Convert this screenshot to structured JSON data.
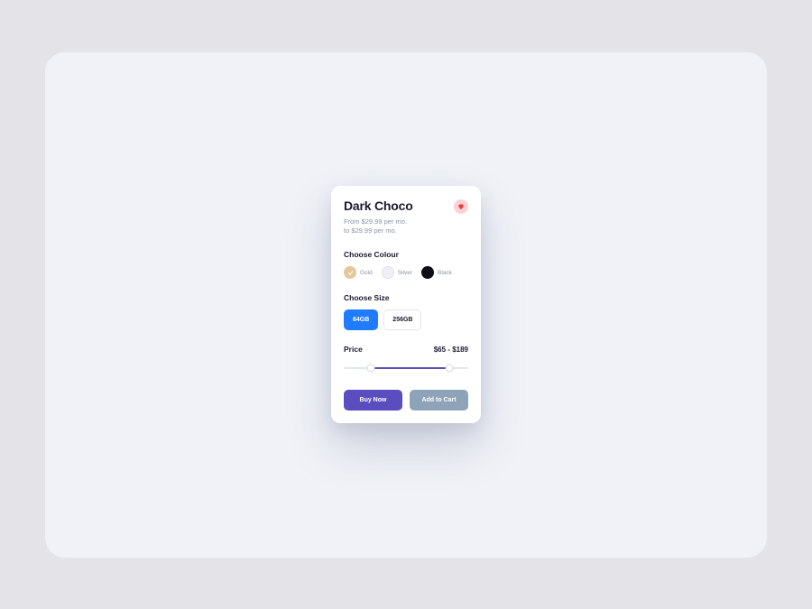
{
  "product": {
    "title": "Dark Choco",
    "subtitle_line1": "From $29.99 per mo.",
    "subtitle_line2": "to $29.99 per mo."
  },
  "favorite": {
    "active": true
  },
  "colour": {
    "label": "Choose Colour",
    "options": [
      {
        "name": "Gold",
        "hex": "#e3c89a",
        "selected": true
      },
      {
        "name": "Silver",
        "hex": "#eef0f5",
        "selected": false
      },
      {
        "name": "Black",
        "hex": "#0e0e14",
        "selected": false
      }
    ]
  },
  "size": {
    "label": "Choose Size",
    "options": [
      {
        "label": "64GB",
        "selected": true
      },
      {
        "label": "256GB",
        "selected": false
      }
    ]
  },
  "price": {
    "label": "Price",
    "display": "$65 - $189",
    "min": 0,
    "max": 200,
    "low": 65,
    "high": 189,
    "low_pct": 22,
    "high_pct": 85
  },
  "actions": {
    "buy_label": "Buy Now",
    "cart_label": "Add to Cart"
  }
}
